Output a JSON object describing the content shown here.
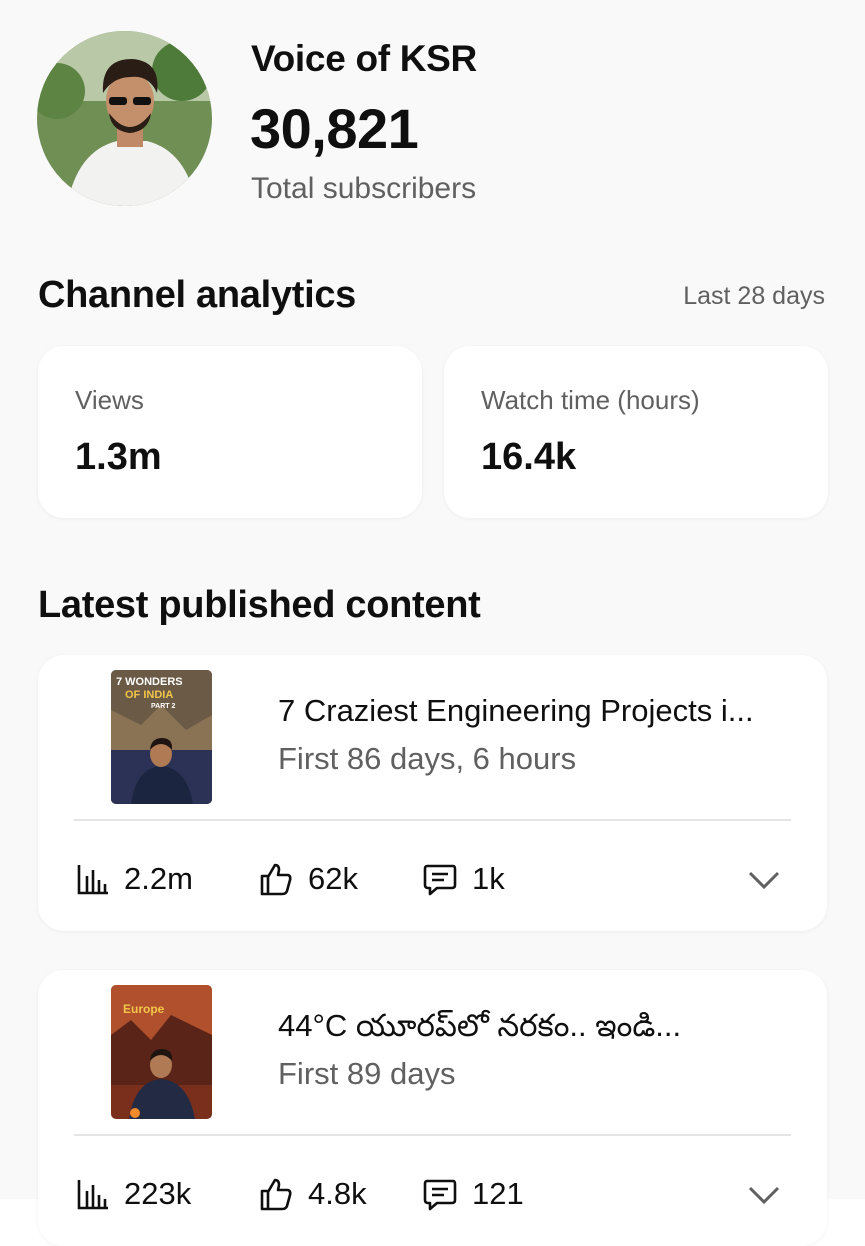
{
  "channel": {
    "name": "Voice of KSR",
    "subscriber_count": "30,821",
    "subscriber_label": "Total subscribers"
  },
  "analytics": {
    "title": "Channel analytics",
    "period": "Last 28 days",
    "stats": [
      {
        "label": "Views",
        "value": "1.3m"
      },
      {
        "label": "Watch time (hours)",
        "value": "16.4k"
      }
    ]
  },
  "latest": {
    "title": "Latest published content",
    "items": [
      {
        "title": "7 Craziest Engineering Projects i...",
        "age": "First 86 days, 6 hours",
        "views": "2.2m",
        "likes": "62k",
        "comments": "1k",
        "thumbnail_text": [
          "7 WONDERS",
          "OF INDIA",
          "PART 2"
        ]
      },
      {
        "title": "44°C యూరప్‌లో నరకం.. ఇండి...",
        "age": "First 89 days",
        "views": "223k",
        "likes": "4.8k",
        "comments": "121",
        "thumbnail_text": [
          "Europe"
        ]
      }
    ]
  },
  "icons": {
    "views": "bar-chart-icon",
    "likes": "thumbs-up-icon",
    "comments": "comment-icon",
    "expand": "chevron-down-icon"
  },
  "colors": {
    "text_primary": "#0f0f0f",
    "text_secondary": "#606060",
    "card_bg": "#ffffff",
    "page_bg": "#f9f9f9"
  }
}
